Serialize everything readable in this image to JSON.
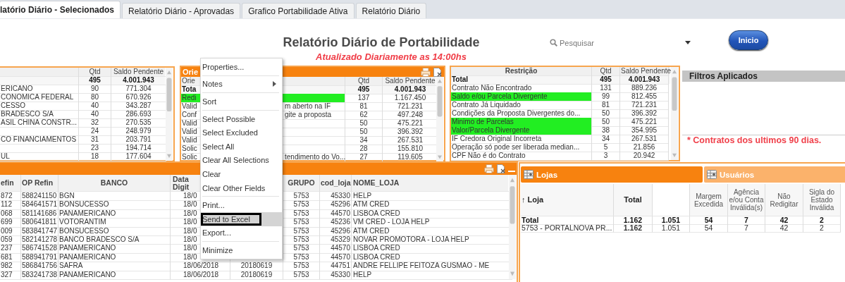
{
  "tabs": [
    {
      "label": "latório Diário - Selecionados",
      "selected": true
    },
    {
      "label": "Relatório Diário - Aprovadas",
      "selected": false
    },
    {
      "label": "Grafico Portabilidade Ativa",
      "selected": false
    },
    {
      "label": "Relatório Diário",
      "selected": false
    }
  ],
  "header": {
    "title": "Relatório Diário de Portabilidade",
    "subtitle": "Atualizado Diariamente as 14:00hs"
  },
  "search": {
    "placeholder": "Pesquisar"
  },
  "start_button": {
    "label": "Inicio"
  },
  "bank_list": {
    "columns": {
      "qtd": "Qtd",
      "saldo": "Saldo Pendente"
    },
    "total": {
      "qtd": "495",
      "saldo": "4.001.943"
    },
    "rows": [
      {
        "name": "ERICANO",
        "qtd": "90",
        "saldo": "771.304"
      },
      {
        "name": "CONOMICA FEDERAL",
        "qtd": "80",
        "saldo": "670.926"
      },
      {
        "name": "CESSO",
        "qtd": "40",
        "saldo": "343.287"
      },
      {
        "name": "BRADESCO S/A",
        "qtd": "40",
        "saldo": "286.693"
      },
      {
        "name": "ASIL CHINA CONSTR...",
        "qtd": "32",
        "saldo": "270.535"
      },
      {
        "qtd": "24",
        "saldo": "248.979"
      },
      {
        "name": "CO FINANCIAMENTOS",
        "qtd": "31",
        "saldo": "203.791"
      },
      {
        "qtd": "23",
        "saldo": "194.714"
      },
      {
        "name": "UL",
        "qtd": "18",
        "saldo": "177.604"
      }
    ]
  },
  "orientation_list": {
    "title": "Orie",
    "columns": {
      "name": "Orie",
      "qtd": "Qtd",
      "saldo": "Saldo Pendente"
    },
    "total": {
      "name": "Tota",
      "qtd": "495",
      "saldo": "4.001.943"
    },
    "rows": [
      {
        "name": "Redi",
        "qtd": "137",
        "saldo": "1.167.450",
        "highlighted": true
      },
      {
        "name": "Valid",
        "name_end": "m aberto na IF",
        "qtd": "81",
        "saldo": "721.231",
        "highlighted": false
      },
      {
        "name": "Conf",
        "name_end": "gite a proposta",
        "qtd": "62",
        "saldo": "497.248",
        "highlighted": false
      },
      {
        "name": "Valid",
        "qtd": "50",
        "saldo": "475.221",
        "highlighted": false
      },
      {
        "name": "Valid",
        "qtd": "50",
        "saldo": "396.392",
        "highlighted": false
      },
      {
        "name": "Valid",
        "qtd": "34",
        "saldo": "267.531",
        "highlighted": false
      },
      {
        "name": "Solic",
        "qtd": "28",
        "saldo": "155.810",
        "highlighted": false
      },
      {
        "name": "Solic",
        "name_end": "tendimento do Vo...",
        "qtd": "27",
        "saldo": "119.605",
        "highlighted": false
      }
    ]
  },
  "restriction_list": {
    "columns": {
      "name": "Restrição",
      "qtd": "Qtd",
      "saldo": "Saldo Pendente"
    },
    "total": {
      "name": "Total",
      "qtd": "495",
      "saldo": "4.001.943"
    },
    "rows": [
      {
        "name": "Contrato Não Encontrado",
        "qtd": "131",
        "saldo": "889.236",
        "highlighted": false
      },
      {
        "name": "Saldo e/ou Parcela Divergente",
        "qtd": "99",
        "saldo": "812.455",
        "highlighted": true
      },
      {
        "name": "Contrato Já Liquidado",
        "qtd": "81",
        "saldo": "721.231",
        "highlighted": false
      },
      {
        "name": "Condições da Proposta Divergentes do...",
        "qtd": "50",
        "saldo": "396.392",
        "highlighted": false
      },
      {
        "name": "Minimo de Parcelas",
        "qtd": "50",
        "saldo": "475.221",
        "highlighted": true
      },
      {
        "name": "Valor/Parcela Divergente",
        "qtd": "38",
        "saldo": "354.995",
        "highlighted": true
      },
      {
        "name": "IF Credora Original Incorreta",
        "qtd": "34",
        "saldo": "267.531",
        "highlighted": false
      },
      {
        "name": "Operação só pode ser liberada median...",
        "qtd": "5",
        "saldo": "21.856",
        "highlighted": false
      },
      {
        "name": "CPF Não é do Contrato",
        "qtd": "3",
        "saldo": "20.942",
        "highlighted": false
      }
    ]
  },
  "applied_filters": {
    "title": "Filtros Aplicados",
    "note": "* Contratos dos ultimos 90 dias."
  },
  "contracts_table": {
    "columns": {
      "refin": "efin",
      "op_refin": "OP Refin",
      "banco": "BANCO",
      "data_digit": "Data\nDigit",
      "grupo": "GRUPO",
      "cod_loja": "cod_loja",
      "nome_loja": "NOME_LOJA"
    },
    "rows": [
      {
        "refin": "872",
        "op_refin": "588241150",
        "banco": "BGN",
        "data_digit": "18/0",
        "grupo": "5753",
        "cod_loja": "45330",
        "nome_loja": "HELP"
      },
      {
        "refin": "112",
        "op_refin": "584641571",
        "banco": "BONSUCESSO",
        "data_digit": "18/0",
        "grupo": "5753",
        "cod_loja": "45296",
        "nome_loja": "ATM CRED"
      },
      {
        "refin": "068",
        "op_refin": "581141686",
        "banco": "PANAMERICANO",
        "data_digit": "18/0",
        "grupo": "5753",
        "cod_loja": "44570",
        "nome_loja": "LISBOA CRED"
      },
      {
        "refin": "699",
        "op_refin": "580641811",
        "banco": "VOTORANTIM",
        "data_digit": "18/0",
        "grupo": "5753",
        "cod_loja": "45236",
        "nome_loja": "VM CRED - LOJA HELP"
      },
      {
        "refin": "009",
        "op_refin": "583841747",
        "banco": "BONSUCESSO",
        "data_digit": "18/0",
        "grupo": "5753",
        "cod_loja": "45296",
        "nome_loja": "ATM CRED"
      },
      {
        "refin": "059",
        "op_refin": "582141278",
        "banco": "BANCO BRADESCO S/A",
        "data_digit": "18/0",
        "grupo": "5753",
        "cod_loja": "45329",
        "nome_loja": "NOVAR PROMOTORA - LOJA HELP"
      },
      {
        "refin": "237",
        "op_refin": "586741528",
        "banco": "PANAMERICANO",
        "data_digit": "18/0",
        "grupo": "5753",
        "cod_loja": "44570",
        "nome_loja": "LISBOA CRED"
      },
      {
        "refin": "681",
        "op_refin": "588941791",
        "banco": "PANAMERICANO",
        "data_digit": "18/0",
        "grupo": "5753",
        "cod_loja": "44570",
        "nome_loja": "LISBOA CRED"
      },
      {
        "refin": "982",
        "op_refin": "586841756",
        "banco": "SAFRA",
        "data_digit": "18/06/2018",
        "column_5": "20180619",
        "grupo": "5753",
        "cod_loja": "44751",
        "nome_loja": "ANDRE FELLIPE FEITOZA GUSMAO - ME"
      },
      {
        "refin": "327",
        "op_refin": "583241738",
        "banco": "PANAMERICANO",
        "data_digit": "18/06/2018",
        "column_5": "20180619",
        "grupo": "5753",
        "cod_loja": "45330",
        "nome_loja": "HELP"
      }
    ]
  },
  "stores_panel": {
    "tabs": [
      {
        "label": "Lojas",
        "selected": true
      },
      {
        "label": "Usuários",
        "selected": false
      }
    ],
    "columns": {
      "loja": "↑ Loja",
      "total": "Total",
      "margem": "Margem Excedida",
      "agencia": "Agência e/ou Conta Inválida(s)",
      "nao_redigitar": "Não Redigitar",
      "sigla": "Sigla do Estado Inválida"
    },
    "total": {
      "loja": "Total",
      "total": "1.162",
      "column_3": "1.051",
      "margem": "54",
      "agencia": "7",
      "nao_redigitar": "42",
      "sigla": "2"
    },
    "rows": [
      {
        "loja": "5753 - PORTALNOVA PR...",
        "total": "1.162",
        "column_3": "1.051",
        "margem": "54",
        "agencia": "7",
        "nao_redigitar": "42",
        "sigla": "2"
      }
    ]
  },
  "context_menu": {
    "items": [
      {
        "kind": "item",
        "label": "Properties...",
        "selected": false
      },
      {
        "kind": "separator"
      },
      {
        "kind": "submenu",
        "label": "Notes",
        "selected": false
      },
      {
        "kind": "separator"
      },
      {
        "kind": "item",
        "label": "Sort",
        "selected": false
      },
      {
        "kind": "separator"
      },
      {
        "kind": "item",
        "label": "Select Possible",
        "selected": false
      },
      {
        "kind": "item",
        "label": "Select Excluded",
        "selected": false
      },
      {
        "kind": "item",
        "label": "Select All",
        "selected": false
      },
      {
        "kind": "item",
        "label": "Clear All Selections",
        "selected": false
      },
      {
        "kind": "item",
        "label": "Clear",
        "selected": false
      },
      {
        "kind": "item",
        "label": "Clear Other Fields",
        "selected": false
      },
      {
        "kind": "separator"
      },
      {
        "kind": "item",
        "label": "Print...",
        "selected": false
      },
      {
        "kind": "item",
        "label": "Send to Excel",
        "selected": true,
        "framed": true
      },
      {
        "kind": "item",
        "label": "Export...",
        "selected": false
      },
      {
        "kind": "separator"
      },
      {
        "kind": "item",
        "label": "Minimize",
        "selected": false
      }
    ]
  }
}
